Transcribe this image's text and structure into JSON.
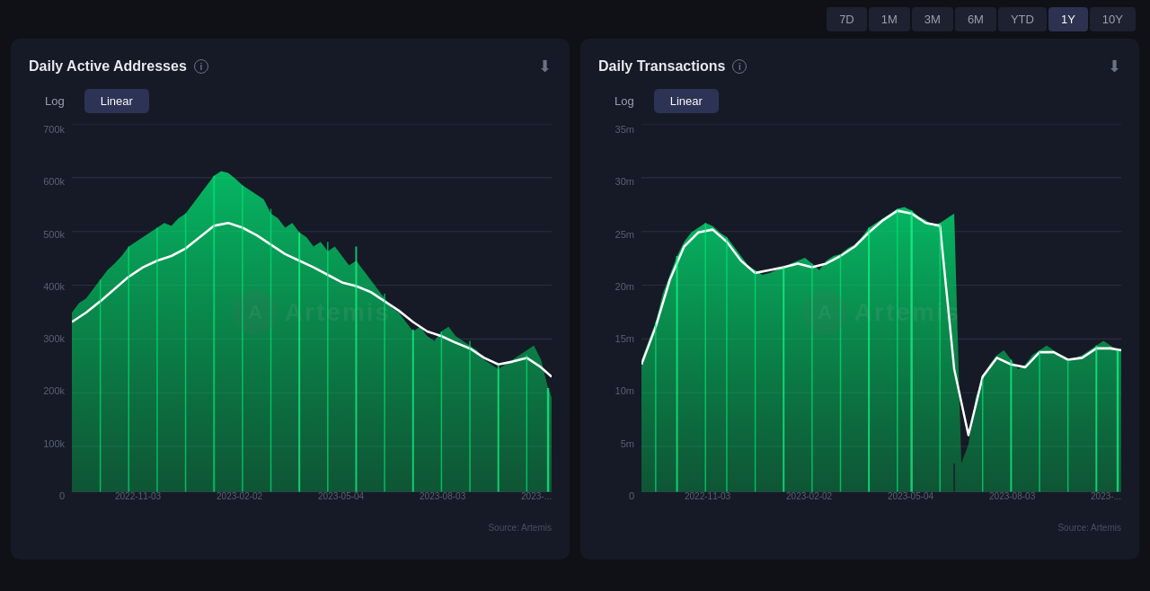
{
  "timeButtons": [
    "7D",
    "1M",
    "3M",
    "6M",
    "YTD",
    "1Y",
    "10Y"
  ],
  "activeTime": "1Y",
  "chart1": {
    "title": "Daily Active Addresses",
    "toggleLog": "Log",
    "toggleLinear": "Linear",
    "activeToggle": "Linear",
    "yLabels": [
      "700k",
      "600k",
      "500k",
      "400k",
      "300k",
      "200k",
      "100k",
      "0"
    ],
    "xLabels": [
      "2022-11-03",
      "2023-02-02",
      "2023-05-04",
      "2023-08-03",
      "2023-..."
    ],
    "source": "Source: Artemis",
    "watermark": "Artemis"
  },
  "chart2": {
    "title": "Daily Transactions",
    "toggleLog": "Log",
    "toggleLinear": "Linear",
    "activeToggle": "Linear",
    "yLabels": [
      "35m",
      "30m",
      "25m",
      "20m",
      "15m",
      "10m",
      "5m",
      "0"
    ],
    "xLabels": [
      "2022-11-03",
      "2023-02-02",
      "2023-05-04",
      "2023-08-03",
      "2023-..."
    ],
    "source": "Source: Artemis",
    "watermark": "Artemis"
  }
}
